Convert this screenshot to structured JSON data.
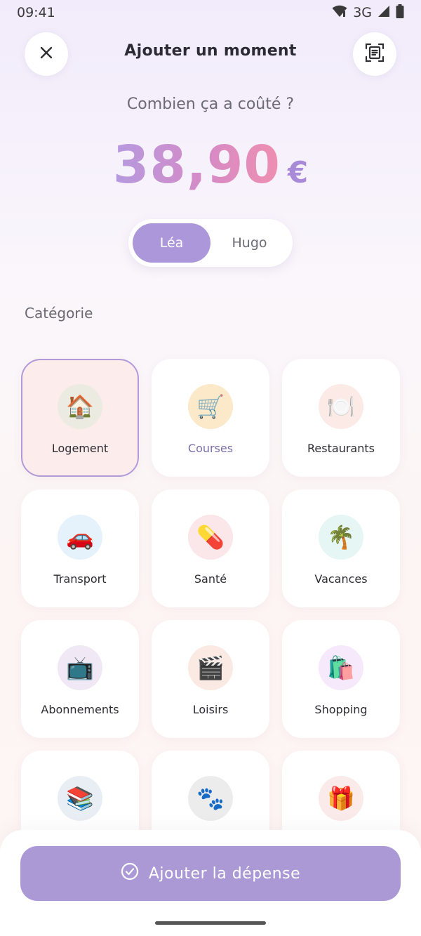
{
  "status_bar": {
    "time": "09:41",
    "network": "3G"
  },
  "header": {
    "title": "Ajouter un moment",
    "close_icon": "close-icon",
    "scan_icon": "scan-receipt-icon"
  },
  "prompt": "Combien ça a coûté ?",
  "amount": {
    "value": "38,90",
    "currency": "€"
  },
  "payer_toggle": {
    "options": [
      "Léa",
      "Hugo"
    ],
    "selected": "Léa"
  },
  "category_section": {
    "label": "Catégorie"
  },
  "categories": [
    {
      "label": "Logement",
      "emoji": "🏠",
      "bg": "#ecebe1",
      "selected": true
    },
    {
      "label": "Courses",
      "emoji": "🛒",
      "bg": "#fbe9c9",
      "selected": false
    },
    {
      "label": "Restaurants",
      "emoji": "🍽️",
      "bg": "#fbeae6",
      "selected": false
    },
    {
      "label": "Transport",
      "emoji": "🚗",
      "bg": "#e6f2fb",
      "selected": false
    },
    {
      "label": "Santé",
      "emoji": "💊",
      "bg": "#fbe6ea",
      "selected": false
    },
    {
      "label": "Vacances",
      "emoji": "🌴",
      "bg": "#e5f6f5",
      "selected": false
    },
    {
      "label": "Abonnements",
      "emoji": "📺",
      "bg": "#f0e8f5",
      "selected": false
    },
    {
      "label": "Loisirs",
      "emoji": "🎬",
      "bg": "#fbeae3",
      "selected": false
    },
    {
      "label": "Shopping",
      "emoji": "🛍️",
      "bg": "#f6e9fb",
      "selected": false
    },
    {
      "label": "",
      "emoji": "📚",
      "bg": "#e9eef4",
      "selected": false
    },
    {
      "label": "",
      "emoji": "🐾",
      "bg": "#ececec",
      "selected": false
    },
    {
      "label": "",
      "emoji": "🎁",
      "bg": "#fbeaea",
      "selected": false
    }
  ],
  "cta": {
    "label": "Ajouter la dépense",
    "icon": "check-circle-icon"
  },
  "colors": {
    "accent": "#ab97d9",
    "selected_card_bg": "#fcecec",
    "amount_gradient": [
      "#b59ae0",
      "#ef8fb0"
    ]
  }
}
